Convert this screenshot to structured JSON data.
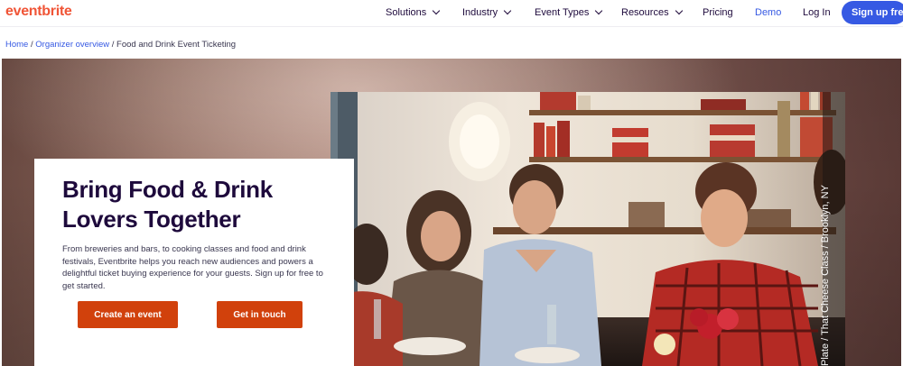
{
  "brand": {
    "logo": "eventbrite",
    "color": "#f05537"
  },
  "nav": {
    "items": [
      {
        "label": "Solutions",
        "has_dropdown": true
      },
      {
        "label": "Industry",
        "has_dropdown": true
      },
      {
        "label": "Event Types",
        "has_dropdown": true
      },
      {
        "label": "Resources",
        "has_dropdown": true
      },
      {
        "label": "Pricing",
        "has_dropdown": false
      },
      {
        "label": "Demo",
        "has_dropdown": false
      },
      {
        "label": "Log In",
        "has_dropdown": false
      }
    ],
    "signup": "Sign up free",
    "accent": "#3659e3"
  },
  "breadcrumb": {
    "home": "Home",
    "separator": " / ",
    "organizer": "Organizer overview",
    "current": "Food and Drink Event Ticketing"
  },
  "hero": {
    "title": "Bring Food & Drink Lovers Together",
    "description": "From breweries and bars, to cooking classes and food and drink festivals, Eventbrite helps you reach new audiences and powers a delightful ticket buying experience for your guests. Sign up for free to get started.",
    "primary_button": "Create an event",
    "secondary_button": "Get in touch",
    "button_color": "#d1410c",
    "photo_credit": "Plate / That Cheese Class / Brooklyn, NY"
  }
}
